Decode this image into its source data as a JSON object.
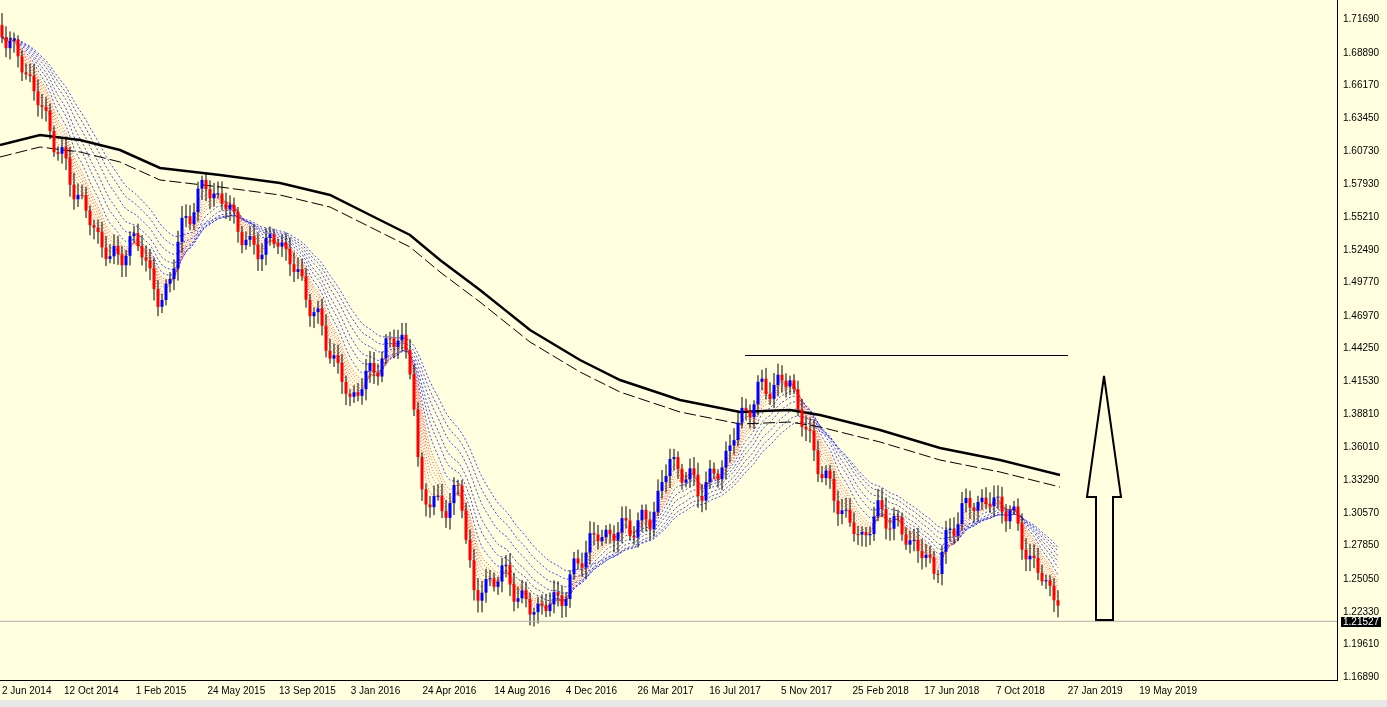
{
  "price_axis": {
    "labels": [
      "1.71690",
      "1.68890",
      "1.66170",
      "1.63450",
      "1.60730",
      "1.57930",
      "1.55210",
      "1.52490",
      "1.49770",
      "1.46970",
      "1.44250",
      "1.41530",
      "1.38810",
      "1.36010",
      "1.33290",
      "1.30570",
      "1.27850",
      "1.25050",
      "1.22330",
      "1.19610",
      "1.16890"
    ],
    "current_price": "1.21527"
  },
  "time_axis": {
    "labels": [
      "2 Jun 2014",
      "12 Oct 2014",
      "1 Feb 2015",
      "24 May 2015",
      "13 Sep 2015",
      "3 Jan 2016",
      "24 Apr 2016",
      "14 Aug 2016",
      "4 Dec 2016",
      "26 Mar 2017",
      "16 Jul 2017",
      "5 Nov 2017",
      "25 Feb 2018",
      "17 Jun 2018",
      "7 Oct 2018",
      "27 Jan 2019",
      "19 May 2019"
    ]
  }
}
